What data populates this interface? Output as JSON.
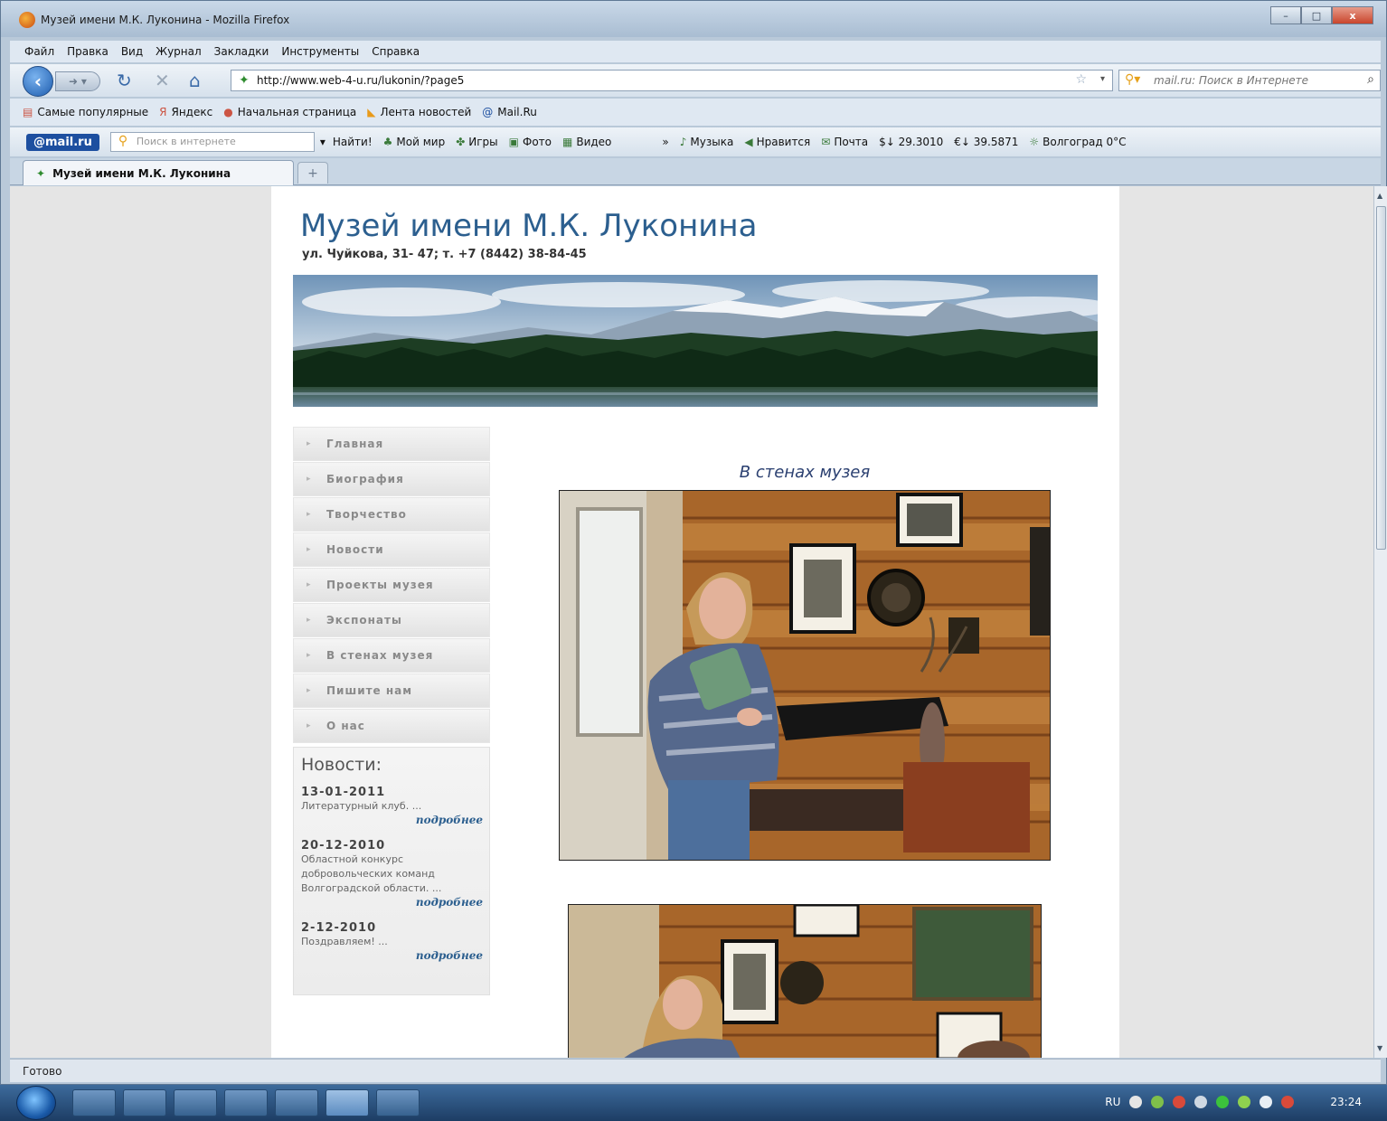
{
  "window": {
    "title": "Музей имени М.К. Луконина - Mozilla Firefox",
    "buttons": {
      "minimize": "–",
      "maximize": "□",
      "close": "x"
    }
  },
  "menubar": [
    "Файл",
    "Правка",
    "Вид",
    "Журнал",
    "Закладки",
    "Инструменты",
    "Справка"
  ],
  "navigation": {
    "url": "http://www.web-4-u.ru/lukonin/?page5",
    "search_placeholder": "mail.ru: Поиск в Интернете"
  },
  "bookmarks": [
    "Самые популярные",
    "Яндекс",
    "Начальная страница",
    "Лента новостей",
    "Mail.Ru"
  ],
  "mailbar": {
    "logo": "@mail.ru",
    "search_placeholder": "Поиск в интернете",
    "find_button": "Найти!",
    "items": [
      "Мой мир",
      "Игры",
      "Фото",
      "Видео",
      "»",
      "Музыка",
      "Нравится",
      "Почта",
      "$↓ 29.3010",
      "€↓ 39.5871",
      "Волгоград 0°C"
    ]
  },
  "tabs": [
    {
      "label": "Музей имени М.К. Луконина",
      "active": true
    }
  ],
  "page": {
    "site_title": "Музей имени М.К. Луконина",
    "address": "ул. Чуйкова, 31- 47; т. +7 (8442) 38-84-45",
    "menu": [
      "Главная",
      "Биография",
      "Творчество",
      "Новости",
      "Проекты музея",
      "Экспонаты",
      "В стенах музея",
      "Пишите нам",
      "О нас"
    ],
    "news": {
      "heading": "Новости:",
      "items": [
        {
          "date": "13-01-2011",
          "text": "Литературный клуб. ...",
          "more": "подробнее"
        },
        {
          "date": "20-12-2010",
          "text": "Областной конкурс добровольческих команд Волгоградской области. ...",
          "more": "подробнее"
        },
        {
          "date": "2-12-2010",
          "text": "Поздравляем! ...",
          "more": "подробнее"
        }
      ]
    },
    "gallery_caption": "В стенах музея"
  },
  "status": "Готово",
  "taskbar": {
    "lang": "RU",
    "time": "23:24"
  },
  "colors": {
    "title_blue": "#2c5f8f",
    "caption_blue": "#2a3f70",
    "menu_text": "#8a8a8a"
  }
}
